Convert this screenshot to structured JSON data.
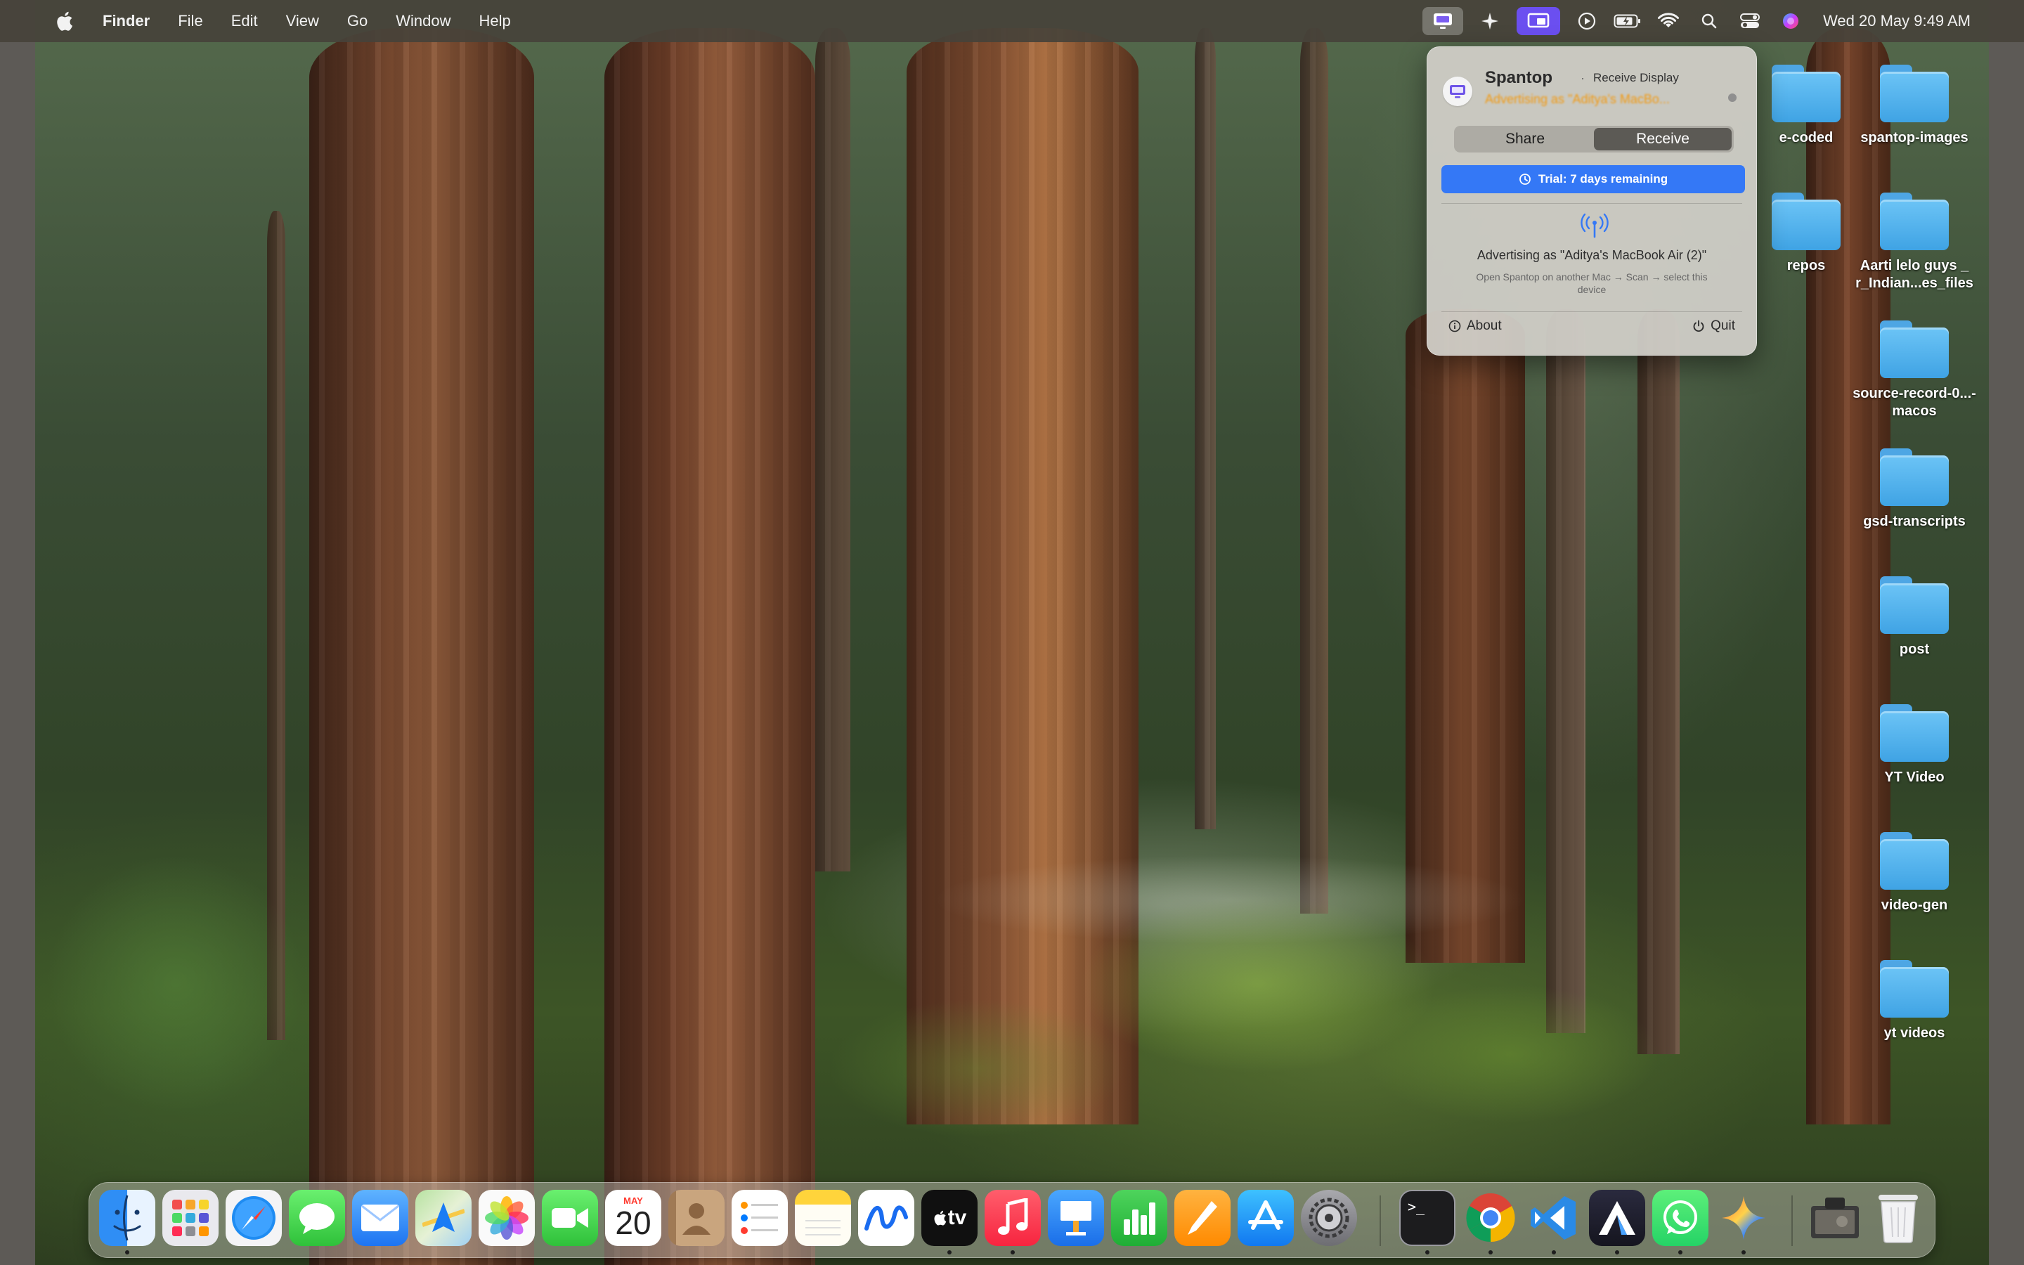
{
  "menubar": {
    "app_name": "Finder",
    "menus": [
      "File",
      "Edit",
      "View",
      "Go",
      "Window",
      "Help"
    ],
    "status_icons": [
      "spantop-icon",
      "sparkle-icon",
      "screen-mirror-icon",
      "play-icon",
      "battery-icon",
      "wifi-icon",
      "search-icon",
      "control-center-icon",
      "siri-icon"
    ],
    "clock": "Wed 20 May  9:49 AM"
  },
  "popover": {
    "app_title": "Spantop",
    "separator": "·",
    "mode": "Receive Display",
    "status": "Advertising as \"Aditya's MacBo...",
    "tabs": [
      {
        "label": "Share",
        "selected": false
      },
      {
        "label": "Receive",
        "selected": true
      }
    ],
    "trial": "Trial: 7 days remaining",
    "advertising": "Advertising as \"Aditya's MacBook Air (2)\"",
    "hint": "Open Spantop on another Mac → Scan → select this device",
    "about": "About",
    "quit": "Quit",
    "accent_color": "#3478f6",
    "status_color": "#f29a12"
  },
  "desktop_icons": {
    "partial": [
      {
        "label": "e-coded"
      },
      {
        "label": "repos"
      }
    ],
    "column": [
      {
        "label": "spantop-images"
      },
      {
        "label": "Aarti lelo guys _ r_Indian...es_files"
      },
      {
        "label": "source-record-0...-macos"
      },
      {
        "label": "gsd-transcripts"
      },
      {
        "label": "post"
      },
      {
        "label": "YT Video"
      },
      {
        "label": "video-gen"
      },
      {
        "label": "yt videos"
      }
    ]
  },
  "dock": {
    "calendar_month": "MAY",
    "calendar_day": "20",
    "tv_label": "tv",
    "terminal_prompt": ">_",
    "apps": [
      "Finder",
      "Launchpad",
      "Safari",
      "Messages",
      "Mail",
      "Maps",
      "Photos",
      "FaceTime",
      "Calendar",
      "Contacts",
      "Reminders",
      "Notes",
      "Freeform",
      "TV",
      "Music",
      "Keynote",
      "Numbers",
      "Pages",
      "App Store",
      "System Settings",
      "Terminal",
      "Chrome",
      "VS Code",
      "Affinity",
      "WhatsApp",
      "Gemini",
      "Screenshot",
      "Trash"
    ]
  }
}
